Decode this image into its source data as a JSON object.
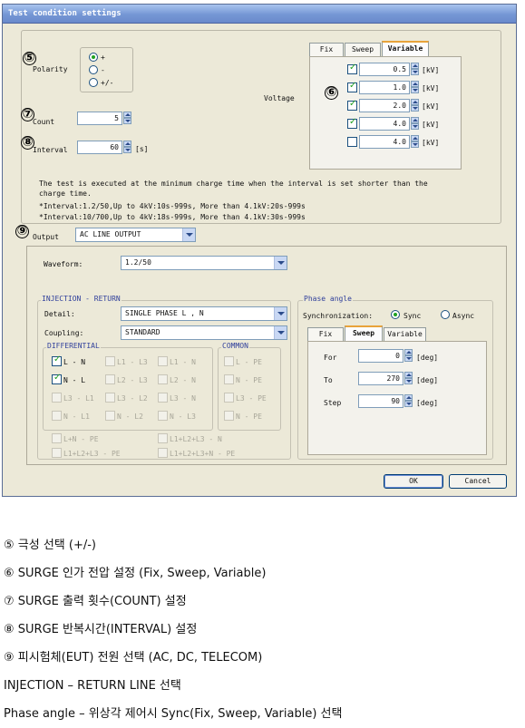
{
  "window": {
    "title": "Test condition settings"
  },
  "markers": [
    "⑤",
    "⑥",
    "⑦",
    "⑧",
    "⑨"
  ],
  "polarity": {
    "label": "Polarity",
    "options": [
      "+",
      "-",
      "+/-"
    ],
    "selected": "+"
  },
  "count": {
    "label": "Count",
    "value": "5"
  },
  "interval": {
    "label": "Interval",
    "value": "60",
    "unit": "[s]"
  },
  "voltage": {
    "label": "Voltage",
    "tabs": [
      "Fix",
      "Sweep",
      "Variable"
    ],
    "active_tab": "Variable",
    "rows": [
      {
        "checked": true,
        "value": "0.5",
        "unit": "[kV]"
      },
      {
        "checked": true,
        "value": "1.0",
        "unit": "[kV]"
      },
      {
        "checked": true,
        "value": "2.0",
        "unit": "[kV]"
      },
      {
        "checked": true,
        "value": "4.0",
        "unit": "[kV]"
      },
      {
        "checked": false,
        "value": "4.0",
        "unit": "[kV]"
      }
    ]
  },
  "notes": {
    "line1": "The test is executed at the minimum charge time when the interval is set shorter than the",
    "line2": "charge time.",
    "line3": "*Interval:1.2/50,Up to 4kV:10s-999s, More than 4.1kV:20s-999s",
    "line4": "*Interval:10/700,Up to 4kV:18s-999s, More than 4.1kV:30s-999s"
  },
  "output": {
    "label": "Output",
    "value": "AC LINE OUTPUT"
  },
  "waveform": {
    "label": "Waveform:",
    "value": "1.2/50"
  },
  "injection": {
    "title": "INJECTION - RETURN",
    "detail_label": "Detail:",
    "detail_value": "SINGLE PHASE L , N",
    "coupling_label": "Coupling:",
    "coupling_value": "STANDARD",
    "differential_title": "DIFFERENTIAL",
    "common_title": "COMMON",
    "differential": [
      [
        "L - N",
        "L1 - L3",
        "L1 - N"
      ],
      [
        "N - L",
        "L2 - L3",
        "L2 - N"
      ],
      [
        "L3 - L1",
        "L3 - L2",
        "L3 - N"
      ],
      [
        "N - L1",
        "N - L2",
        "N - L3"
      ]
    ],
    "differential_checked": [
      "L - N",
      "N - L"
    ],
    "common": [
      "L - PE",
      "N - PE",
      "L3 - PE",
      "N - PE"
    ],
    "bottom": [
      "L+N - PE",
      "L1+L2+L3 - N",
      "L1+L2+L3 - PE",
      "L1+L2+L3+N - PE"
    ]
  },
  "phase": {
    "title": "Phase angle",
    "sync_label": "Synchronization:",
    "sync_options": [
      "Sync",
      "Async"
    ],
    "sync_selected": "Sync",
    "tabs": [
      "Fix",
      "Sweep",
      "Variable"
    ],
    "active_tab": "Sweep",
    "rows": [
      {
        "label": "For",
        "value": "0",
        "unit": "[deg]"
      },
      {
        "label": "To",
        "value": "270",
        "unit": "[deg]"
      },
      {
        "label": "Step",
        "value": "90",
        "unit": "[deg]"
      }
    ]
  },
  "buttons": {
    "ok": "OK",
    "cancel": "Cancel"
  },
  "doc_lines": [
    "⑤ 극성 선택 (+/-)",
    "⑥ SURGE 인가 전압 설정 (Fix, Sweep, Variable)",
    "⑦ SURGE 출력 횟수(COUNT) 설정",
    "⑧ SURGE 반복시간(INTERVAL) 설정",
    "⑨ 피시험체(EUT) 전원 선택 (AC, DC, TELECOM)",
    "INJECTION – RETURN LINE 선택",
    "Phase angle – 위상각 제어시 Sync(Fix, Sweep, Variable) 선택"
  ],
  "colors": {
    "title_bar": "#7597d5",
    "window_bg": "#ece9d8",
    "check": "#21a121",
    "tab_highlight": "#e8a33a"
  }
}
